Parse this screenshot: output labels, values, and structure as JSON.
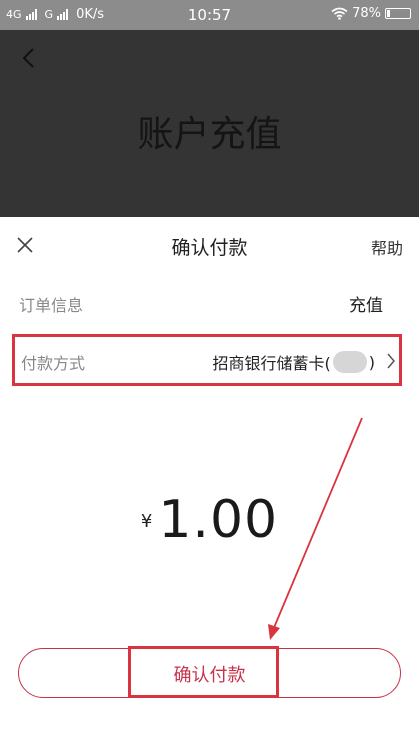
{
  "status_bar": {
    "network_left": "4G",
    "network_second": "G",
    "speed": "0K/s",
    "time": "10:57",
    "battery": "78%"
  },
  "background_page": {
    "title": "账户充值"
  },
  "sheet": {
    "title": "确认付款",
    "help_label": "帮助",
    "order_label": "订单信息",
    "order_value": "充值",
    "payment_label": "付款方式",
    "payment_value_prefix": "招商银行储蓄卡(",
    "payment_value_suffix": ")",
    "currency_symbol": "¥",
    "amount": "1.00",
    "confirm_label": "确认付款"
  },
  "colors": {
    "accent": "#c7324a",
    "highlight": "#d9343f",
    "overlay": "#343434"
  },
  "icons": {
    "back": "back-arrow-icon",
    "close": "close-icon",
    "chevron": "chevron-right-icon",
    "wifi": "wifi-icon",
    "battery": "battery-icon"
  }
}
